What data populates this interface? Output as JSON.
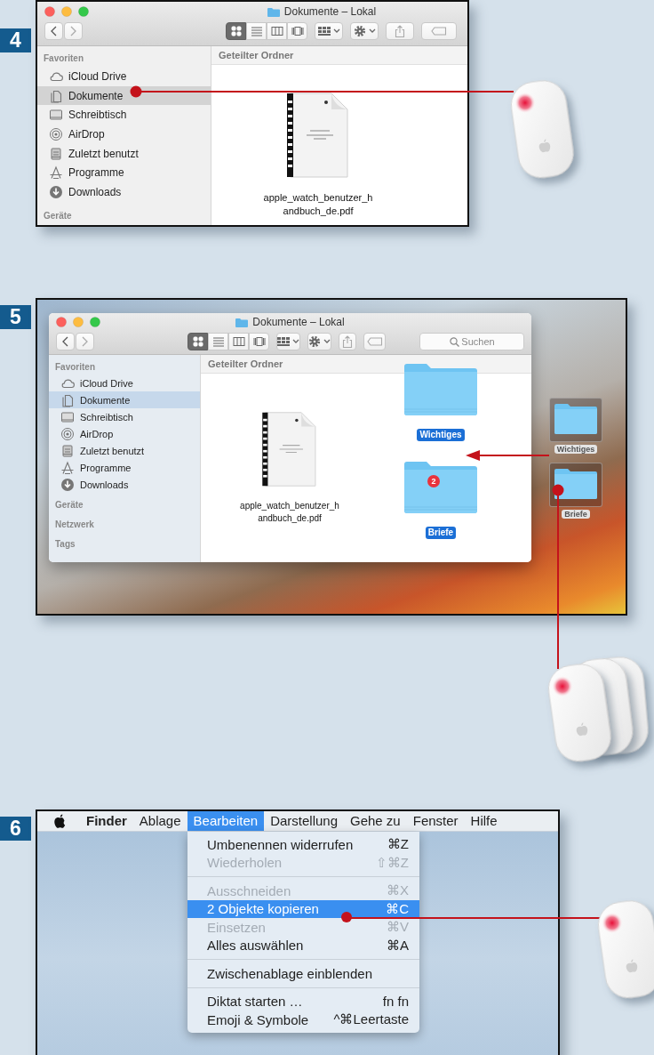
{
  "steps": [
    {
      "number": "4",
      "kind": "finder",
      "window": {
        "title": "Dokumente – Lokal",
        "view_modes": [
          {
            "kind": "icons",
            "selected": true
          },
          {
            "kind": "list",
            "selected": false
          },
          {
            "kind": "columns",
            "selected": false
          },
          {
            "kind": "cover_flow",
            "selected": false
          }
        ],
        "sidebar": [
          {
            "heading": "Favoriten",
            "items": [
              {
                "kind": "cloud",
                "label": "iCloud Drive",
                "selected": false
              },
              {
                "kind": "documents",
                "label": "Dokumente",
                "selected": true
              },
              {
                "kind": "desktop",
                "label": "Schreibtisch",
                "selected": false
              },
              {
                "kind": "airdrop",
                "label": "AirDrop",
                "selected": false
              },
              {
                "kind": "recents",
                "label": "Zuletzt benutzt",
                "selected": false
              },
              {
                "kind": "apps",
                "label": "Programme",
                "selected": false
              },
              {
                "kind": "downloads",
                "label": "Downloads",
                "selected": false
              }
            ]
          },
          {
            "heading": "Geräte"
          }
        ],
        "path_bar": "Geteilter Ordner",
        "files": [
          {
            "kind": "pdf",
            "name_lines": [
              "apple_watch_benutzer_h",
              "andbuch_de.pdf"
            ],
            "selected": false
          }
        ]
      }
    },
    {
      "number": "5",
      "kind": "desktop",
      "window": {
        "title": "Dokumente – Lokal",
        "view_modes": [
          {
            "kind": "icons",
            "selected": true
          },
          {
            "kind": "list",
            "selected": false
          },
          {
            "kind": "columns",
            "selected": false
          },
          {
            "kind": "cover_flow",
            "selected": false
          }
        ],
        "search": {
          "placeholder": "Suchen"
        },
        "sidebar": [
          {
            "heading": "Favoriten",
            "items": [
              {
                "kind": "cloud",
                "label": "iCloud Drive",
                "selected": false
              },
              {
                "kind": "documents",
                "label": "Dokumente",
                "selected": true
              },
              {
                "kind": "desktop",
                "label": "Schreibtisch",
                "selected": false
              },
              {
                "kind": "airdrop",
                "label": "AirDrop",
                "selected": false
              },
              {
                "kind": "recents",
                "label": "Zuletzt benutzt",
                "selected": false
              },
              {
                "kind": "apps",
                "label": "Programme",
                "selected": false
              },
              {
                "kind": "downloads",
                "label": "Downloads",
                "selected": false
              }
            ]
          },
          {
            "heading": "Geräte"
          },
          {
            "heading": "Netzwerk"
          },
          {
            "heading": "Tags"
          }
        ],
        "path_bar": "Geteilter Ordner",
        "files": [
          {
            "kind": "pdf",
            "name_lines": [
              "apple_watch_benutzer_h",
              "andbuch_de.pdf"
            ],
            "selected": false
          },
          {
            "kind": "folder",
            "name_lines": [
              "Wichtiges"
            ],
            "selected": true
          },
          {
            "kind": "folder",
            "name_lines": [
              "Briefe"
            ],
            "selected": true,
            "badge": "2"
          }
        ]
      },
      "desktop_icons": [
        {
          "name": "Wichtiges",
          "selected": true
        },
        {
          "name": "Briefe",
          "selected": true
        }
      ]
    },
    {
      "number": "6",
      "kind": "menu",
      "menubar": [
        {
          "label": "Finder",
          "kind": "app",
          "selected": false
        },
        {
          "label": "Ablage",
          "kind": "menu",
          "selected": false
        },
        {
          "label": "Bearbeiten",
          "kind": "menu",
          "selected": true
        },
        {
          "label": "Darstellung",
          "kind": "menu",
          "selected": false
        },
        {
          "label": "Gehe zu",
          "kind": "menu",
          "selected": false
        },
        {
          "label": "Fenster",
          "kind": "menu",
          "selected": false
        },
        {
          "label": "Hilfe",
          "kind": "menu",
          "selected": false
        }
      ],
      "menu": {
        "groups": [
          {
            "items": [
              {
                "label": "Umbenennen widerrufen",
                "shortcut": "⌘Z",
                "disabled": false,
                "selected": false
              },
              {
                "label": "Wiederholen",
                "shortcut": "⇧⌘Z",
                "disabled": true,
                "selected": false
              }
            ]
          },
          {
            "items": [
              {
                "label": "Ausschneiden",
                "shortcut": "⌘X",
                "disabled": true,
                "selected": false
              },
              {
                "label": "2 Objekte kopieren",
                "shortcut": "⌘C",
                "disabled": false,
                "selected": true
              },
              {
                "label": "Einsetzen",
                "shortcut": "⌘V",
                "disabled": true,
                "selected": false
              },
              {
                "label": "Alles auswählen",
                "shortcut": "⌘A",
                "disabled": false,
                "selected": false
              }
            ]
          },
          {
            "items": [
              {
                "label": "Zwischenablage einblenden",
                "disabled": false,
                "selected": false
              }
            ]
          },
          {
            "items": [
              {
                "label": "Diktat starten …",
                "shortcut": "fn fn",
                "disabled": false,
                "selected": false
              },
              {
                "label": "Emoji & Symbole",
                "shortcut": "^⌘Leertaste",
                "disabled": false,
                "selected": false
              }
            ]
          }
        ]
      }
    }
  ]
}
